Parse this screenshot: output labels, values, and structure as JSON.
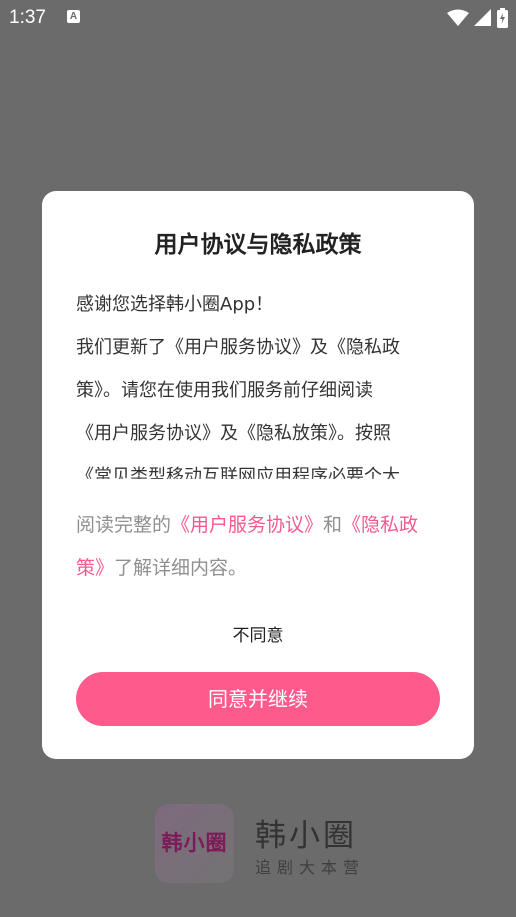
{
  "status_bar": {
    "time": "1:37",
    "a_icon": "A"
  },
  "dialog": {
    "title": "用户协议与隐私政策",
    "body_lines": [
      "感谢您选择韩小圈App！",
      "我们更新了《用户服务协议》及《隐私政",
      "策》。请您在使用我们服务前仔细阅读",
      "《用户服务协议》及《隐私放策》。按照",
      "《常见类型移动互联网应用程序必要个大"
    ],
    "read_prefix": "阅读完整的",
    "user_agreement_link": "《用户服务协议》",
    "read_and": "和",
    "privacy_link_part1": "《隐私政",
    "privacy_link_part2": "策》",
    "read_suffix": "了解详细内容。",
    "disagree_label": "不同意",
    "agree_label": "同意并继续"
  },
  "brand": {
    "logo_text": "韩小圈",
    "name": "韩小圈",
    "slogan": "追剧大本营"
  },
  "colors": {
    "accent": "#ff5a8c",
    "link": "#f45a8e",
    "overlay": "#6b6b6b"
  }
}
